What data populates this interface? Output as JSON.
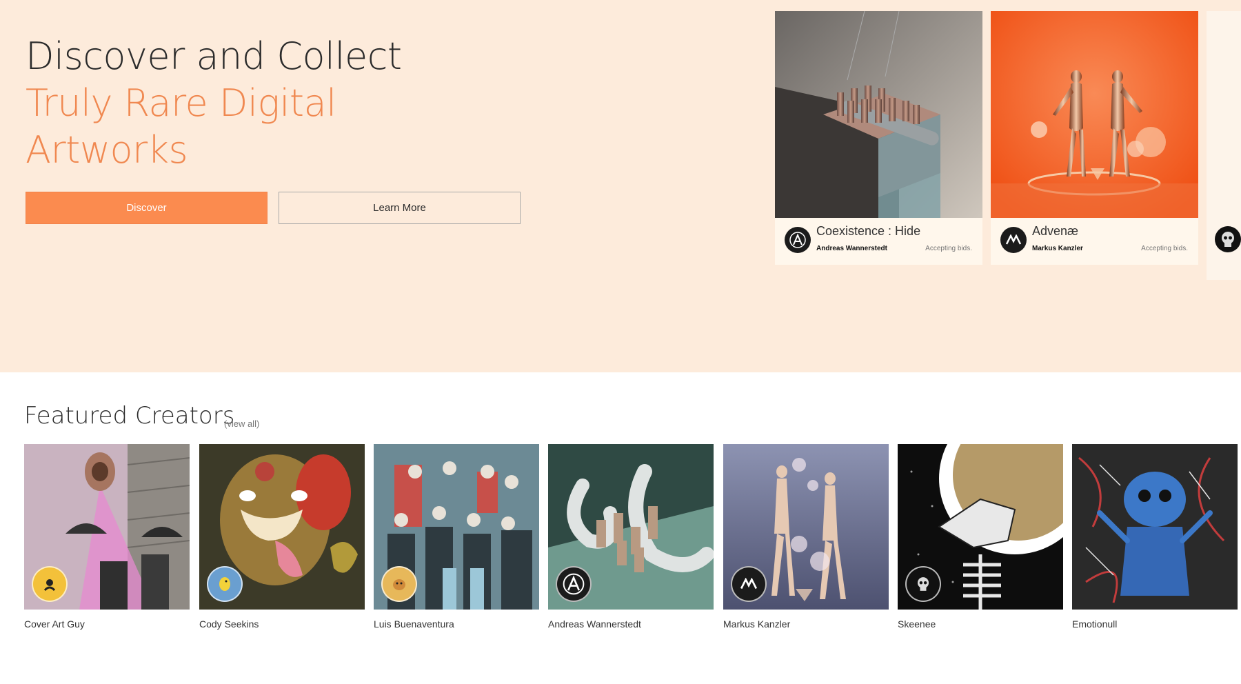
{
  "hero": {
    "title_line1": "Discover and Collect",
    "title_line2": "Truly Rare Digital",
    "title_line3": "Artworks",
    "primary_button": "Discover",
    "secondary_button": "Learn More"
  },
  "featured_artworks": [
    {
      "title": "Coexistence : Hide",
      "creator": "Andreas Wannerstedt",
      "status": "Accepting bids.",
      "avatar_icon": "a-logo-icon"
    },
    {
      "title": "Advenæ",
      "creator": "Markus Kanzler",
      "status": "Accepting bids.",
      "avatar_icon": "mk-logo-icon"
    }
  ],
  "featured_creators": {
    "title": "Featured Creators",
    "view_all": "(view all)",
    "items": [
      {
        "name": "Cover Art Guy"
      },
      {
        "name": "Cody Seekins"
      },
      {
        "name": "Luis Buenaventura"
      },
      {
        "name": "Andreas Wannerstedt"
      },
      {
        "name": "Markus Kanzler"
      },
      {
        "name": "Skeenee"
      },
      {
        "name": "Emotionull"
      }
    ]
  },
  "colors": {
    "hero_bg": "#fdebdb",
    "accent": "#fb8b4f",
    "title_dark": "#2b2b2b"
  }
}
